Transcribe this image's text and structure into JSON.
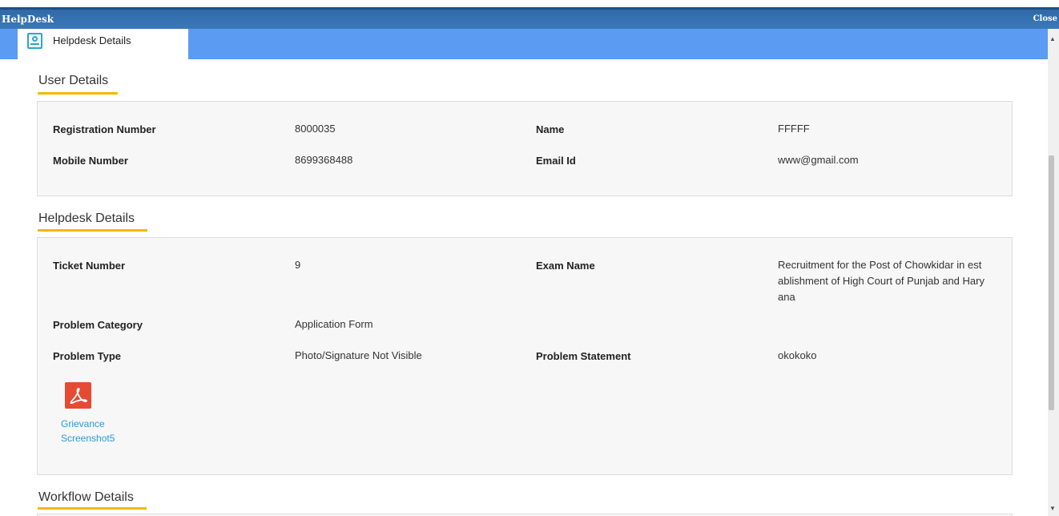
{
  "window": {
    "title": "HelpDesk",
    "close_label": "Close"
  },
  "tab": {
    "label": "Helpdesk Details"
  },
  "user_details": {
    "title": "User Details",
    "registration_label": "Registration Number",
    "registration_value": "8000035",
    "name_label": "Name",
    "name_value": "FFFFF",
    "mobile_label": "Mobile Number",
    "mobile_value": "8699368488",
    "email_label": "Email Id",
    "email_value": "www@gmail.com"
  },
  "helpdesk_details": {
    "title": "Helpdesk Details",
    "ticket_label": "Ticket Number",
    "ticket_value": "9",
    "exam_label": "Exam Name",
    "exam_value_lines": [
      "Recruitment for the Post of Chowkidar in est",
      "ablishment of High Court of Punjab and Hary",
      "ana"
    ],
    "category_label": "Problem Category",
    "category_value": "Application Form",
    "type_label": "Problem Type",
    "type_value": "Photo/Signature Not Visible",
    "statement_label": "Problem Statement",
    "statement_value": "okokoko",
    "attachment": {
      "icon": "pdf-icon",
      "name_lines": [
        "Grievance",
        "Screenshot5"
      ]
    }
  },
  "workflow_details": {
    "title": "Workflow Details"
  },
  "colors": {
    "titlebar": "#3b78b8",
    "tabbar": "#5b9bf2",
    "underline": "#f5b800",
    "link": "#2a9bd8",
    "pdf": "#e64a35"
  }
}
